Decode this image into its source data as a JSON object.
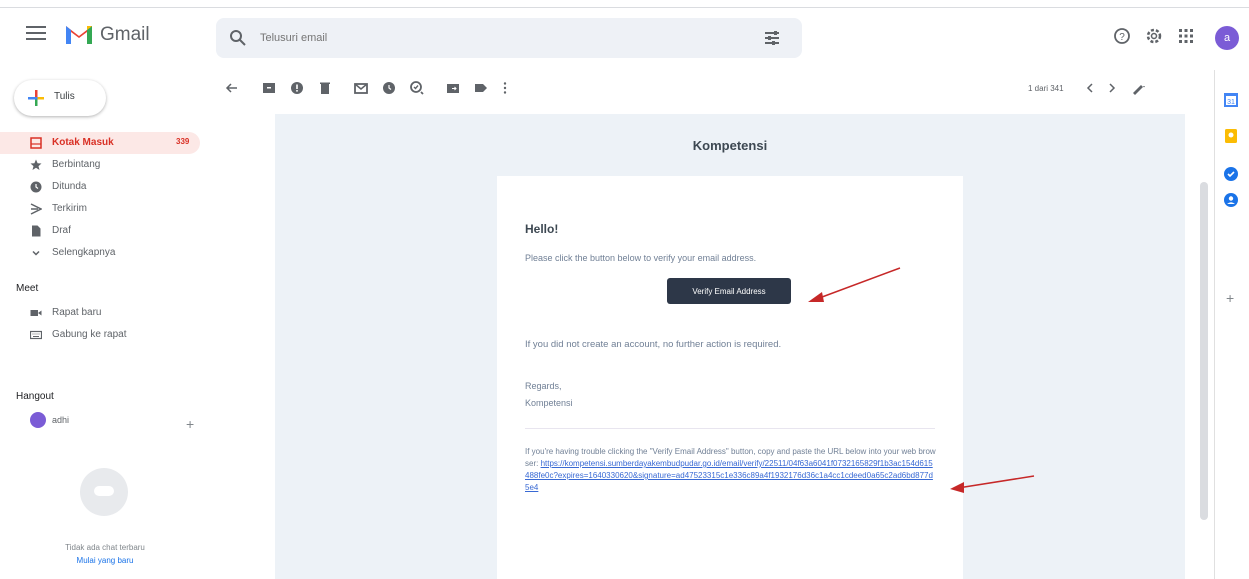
{
  "header": {
    "brand": "Gmail",
    "search_placeholder": "Telusuri email"
  },
  "colors": {
    "active_nav": "#d93025",
    "button_bg": "#2d3748",
    "link": "#3869d4",
    "annotation_arrow": "#c62828"
  },
  "compose": {
    "label": "Tulis"
  },
  "sidebar": {
    "items": [
      {
        "label": "Kotak Masuk",
        "count": "339",
        "icon": "inbox-icon"
      },
      {
        "label": "Berbintang",
        "icon": "star-icon"
      },
      {
        "label": "Ditunda",
        "icon": "clock-icon"
      },
      {
        "label": "Terkirim",
        "icon": "send-icon"
      },
      {
        "label": "Draf",
        "icon": "draft-icon"
      },
      {
        "label": "Selengkapnya",
        "icon": "chevron-down-icon"
      }
    ],
    "meet_title": "Meet",
    "meet_items": [
      {
        "label": "Rapat baru",
        "icon": "video-icon"
      },
      {
        "label": "Gabung ke rapat",
        "icon": "keyboard-icon"
      }
    ],
    "hangout_title": "Hangout",
    "hangout_user": "adhi",
    "no_chat": "Tidak ada chat terbaru",
    "start_new": "Mulai yang baru"
  },
  "toolbar": {
    "pager": "1 dari 341"
  },
  "email": {
    "brand": "Kompetensi",
    "greeting": "Hello!",
    "instruction": "Please click the button below to verify your email address.",
    "button_label": "Verify Email Address",
    "no_action": "If you did not create an account, no further action is required.",
    "regards": "Regards,",
    "signer": "Kompetensi",
    "trouble_text": "If you're having trouble clicking the \"Verify Email Address\" button, copy and paste the URL below into your web browser: ",
    "link": "https://kompetensi.sumberdayakembudpudar.go.id/email/verify/22511/04f63a6041f0732165829f1b3ac154d615488fe0c?expires=1640330620&signature=ad47523315c1e336c89a4f1932176d36c1a4cc1cdeed0a65c2ad6bd877d5e4"
  }
}
